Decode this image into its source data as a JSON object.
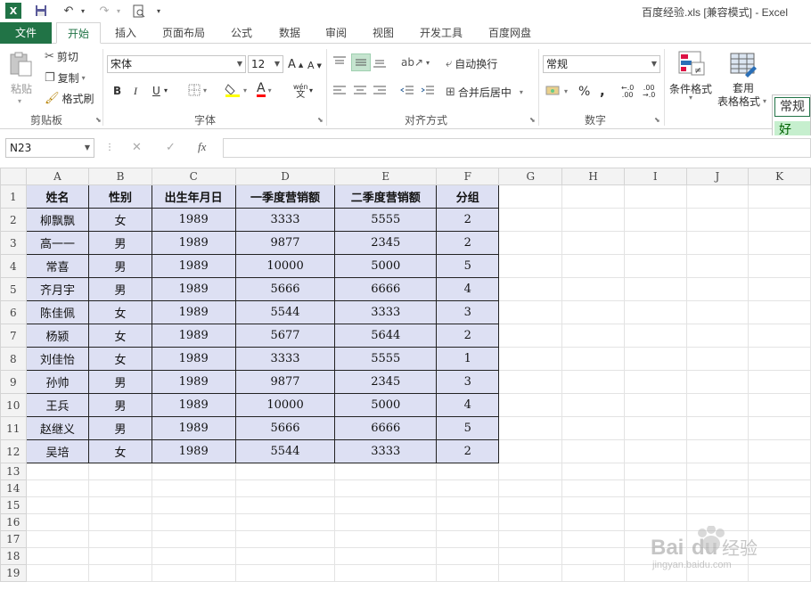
{
  "window": {
    "title": "百度经验.xls  [兼容模式] - Excel"
  },
  "quick_access": {
    "excel_icon": "X",
    "save_icon": "save-icon",
    "undo_icon": "undo-icon",
    "redo_icon": "redo-icon",
    "preview_icon": "print-preview-icon"
  },
  "tabs": [
    {
      "label": "文件"
    },
    {
      "label": "开始"
    },
    {
      "label": "插入"
    },
    {
      "label": "页面布局"
    },
    {
      "label": "公式"
    },
    {
      "label": "数据"
    },
    {
      "label": "审阅"
    },
    {
      "label": "视图"
    },
    {
      "label": "开发工具"
    },
    {
      "label": "百度网盘"
    }
  ],
  "ribbon": {
    "clipboard": {
      "label": "剪贴板",
      "paste": "粘贴",
      "cut": "剪切",
      "copy": "复制",
      "format_painter": "格式刷"
    },
    "font": {
      "label": "字体",
      "font_name": "宋体",
      "font_size": "12",
      "bold": "B",
      "italic": "I",
      "underline": "U",
      "wen": "wén"
    },
    "alignment": {
      "label": "对齐方式",
      "wrap_text": "自动换行",
      "merge_center": "合并后居中"
    },
    "number": {
      "label": "数字",
      "format": "常规",
      "percent": "%",
      "comma": ","
    },
    "styles": {
      "conditional": "条件格式",
      "table_format": "套用",
      "table_format2": "表格格式",
      "normal": "常规",
      "good": "好"
    }
  },
  "formula_bar": {
    "name_box": "N23",
    "fx": "fx",
    "cancel": "✕",
    "enter": "✓",
    "formula": ""
  },
  "colors": {
    "accent": "#217346",
    "data_fill": "#dde0f3",
    "good_fill": "#c6efce"
  },
  "sheet": {
    "columns": [
      "A",
      "B",
      "C",
      "D",
      "E",
      "F",
      "G",
      "H",
      "I",
      "J",
      "K"
    ],
    "rows": [
      "1",
      "2",
      "3",
      "4",
      "5",
      "6",
      "7",
      "8",
      "9",
      "10",
      "11",
      "12",
      "13",
      "14",
      "15",
      "16",
      "17",
      "18",
      "19"
    ],
    "header": [
      "姓名",
      "性别",
      "出生年月日",
      "一季度营销额",
      "二季度营销额",
      "分组"
    ],
    "data": [
      [
        "柳飘飘",
        "女",
        "1989",
        "3333",
        "5555",
        "2"
      ],
      [
        "高一一",
        "男",
        "1989",
        "9877",
        "2345",
        "2"
      ],
      [
        "常喜",
        "男",
        "1989",
        "10000",
        "5000",
        "5"
      ],
      [
        "齐月宇",
        "男",
        "1989",
        "5666",
        "6666",
        "4"
      ],
      [
        "陈佳佩",
        "女",
        "1989",
        "5544",
        "3333",
        "3"
      ],
      [
        "杨颍",
        "女",
        "1989",
        "5677",
        "5644",
        "2"
      ],
      [
        "刘佳怡",
        "女",
        "1989",
        "3333",
        "5555",
        "1"
      ],
      [
        "孙帅",
        "男",
        "1989",
        "9877",
        "2345",
        "3"
      ],
      [
        "王兵",
        "男",
        "1989",
        "10000",
        "5000",
        "4"
      ],
      [
        "赵继义",
        "男",
        "1989",
        "5666",
        "6666",
        "5"
      ],
      [
        "吴培",
        "女",
        "1989",
        "5544",
        "3333",
        "2"
      ]
    ]
  },
  "watermark": {
    "brand": "Bai",
    "brand2": "du",
    "jingyan": "经验",
    "url": "jingyan.baidu.com"
  }
}
